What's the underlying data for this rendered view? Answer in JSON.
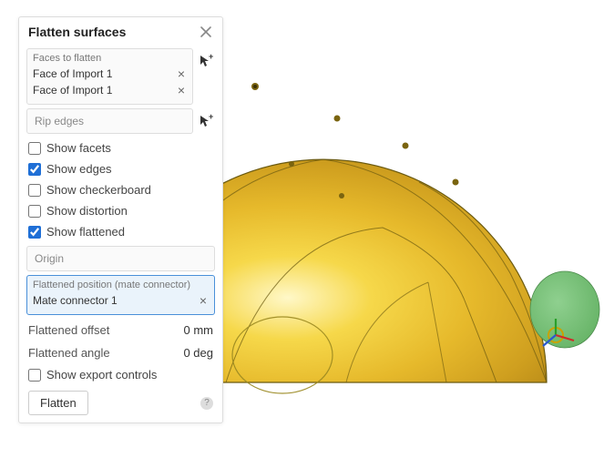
{
  "panel": {
    "title": "Flatten surfaces",
    "faces_to_flatten": {
      "label": "Faces to flatten",
      "items": [
        "Face of Import 1",
        "Face of Import 1"
      ]
    },
    "rip_edges": {
      "placeholder": "Rip edges"
    },
    "checks": {
      "show_facets": {
        "label": "Show facets",
        "checked": false
      },
      "show_edges": {
        "label": "Show edges",
        "checked": true
      },
      "show_checkerboard": {
        "label": "Show checkerboard",
        "checked": false
      },
      "show_distortion": {
        "label": "Show distortion",
        "checked": false
      },
      "show_flattened": {
        "label": "Show flattened",
        "checked": true
      },
      "show_export_controls": {
        "label": "Show export controls",
        "checked": false
      }
    },
    "origin": {
      "placeholder": "Origin"
    },
    "flattened_position": {
      "label": "Flattened position (mate connector)",
      "value": "Mate connector 1"
    },
    "flattened_offset": {
      "label": "Flattened offset",
      "value": "0 mm"
    },
    "flattened_angle": {
      "label": "Flattened angle",
      "value": "0 deg"
    },
    "flatten_button": "Flatten"
  },
  "viewport": {
    "model": "golden-dome-surface",
    "flat_preview": "green-ellipse"
  }
}
